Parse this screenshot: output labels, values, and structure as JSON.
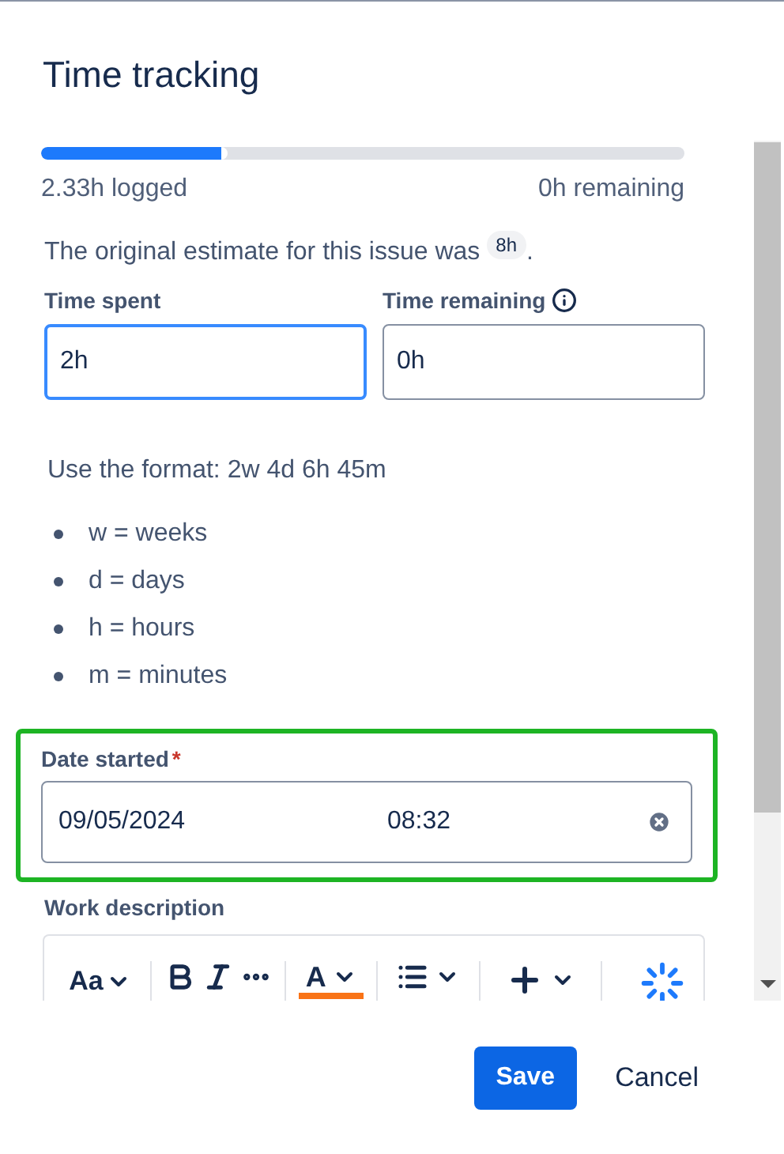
{
  "title": "Time tracking",
  "progress": {
    "level": 0.29,
    "logged": "2.33h logged",
    "remaining": "0h remaining"
  },
  "estimate": {
    "text": "The original estimate for this issue was",
    "badge": "8h",
    "end": "."
  },
  "fields": [
    {
      "label": "Time spent",
      "value": "2h",
      "focused": true,
      "info": false
    },
    {
      "label": "Time remaining",
      "value": "0h",
      "focused": false,
      "info": true
    }
  ],
  "format_hint": "Use the format: 2w 4d 6h 45m",
  "units": [
    "w = weeks",
    "d = days",
    "h = hours",
    "m = minutes"
  ],
  "date_started": {
    "label": "Date started",
    "required": "*",
    "date": "09/05/2024",
    "time": "08:32",
    "highlighted": true
  },
  "work_description": {
    "label": "Work description",
    "toolbar": [
      {
        "kind": "text-style",
        "text": "Aa"
      },
      {
        "kind": "divider"
      },
      {
        "kind": "bold"
      },
      {
        "kind": "italic"
      },
      {
        "kind": "more"
      },
      {
        "kind": "divider"
      },
      {
        "kind": "text-color",
        "text": "A"
      },
      {
        "kind": "divider"
      },
      {
        "kind": "list"
      },
      {
        "kind": "divider"
      },
      {
        "kind": "insert"
      },
      {
        "kind": "divider"
      },
      {
        "kind": "ai"
      }
    ]
  },
  "buttons": [
    {
      "label": "Save",
      "primary": true
    },
    {
      "label": "Cancel",
      "primary": false
    }
  ]
}
